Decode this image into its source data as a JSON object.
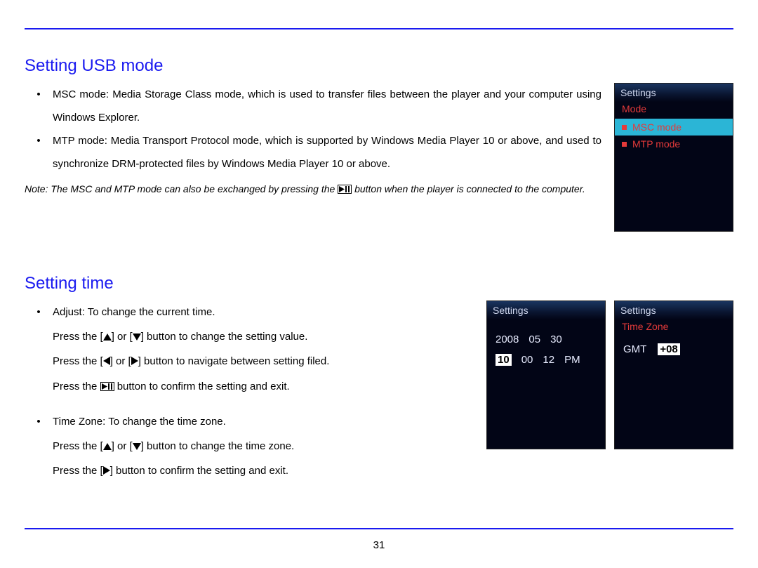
{
  "page_number": "31",
  "sections": {
    "usb": {
      "heading": "Setting USB mode",
      "bullets": [
        "MSC mode: Media Storage Class mode, which is used to transfer files between the player and your computer using Windows Explorer.",
        "MTP mode: Media Transport Protocol mode, which is supported by Windows Media Player 10 or above, and used to synchronize DRM-protected files by Windows Media Player 10 or above."
      ],
      "note_pre": "Note: The MSC and MTP mode can also be exchanged by pressing the ",
      "note_post": " button when the player is connected to the computer."
    },
    "time": {
      "heading": "Setting time",
      "b1": "Adjust: To change the current time.",
      "l1a": "Press the [",
      "l1b": "] or [",
      "l1c": "] button to change the setting value.",
      "l2a": "Press the [",
      "l2b": "] or [",
      "l2c": "] button to navigate between setting filed.",
      "l3a": "Press the ",
      "l3b": " button to confirm the setting and exit.",
      "b2": "Time Zone: To change the time zone.",
      "l4a": "Press the [",
      "l4b": "] or [",
      "l4c": "] button to change the time zone.",
      "l5a": "Press the [",
      "l5b": "] button to confirm the setting and exit."
    }
  },
  "device_usb": {
    "header": "Settings",
    "sub": "Mode",
    "items": [
      {
        "label": "MSC mode",
        "selected": true
      },
      {
        "label": "MTP mode",
        "selected": false
      }
    ]
  },
  "device_time": {
    "header": "Settings",
    "date": {
      "y": "2008",
      "m": "05",
      "d": "30"
    },
    "clock": {
      "hh": "10",
      "mm": "00",
      "ss": "12",
      "ampm": "PM"
    }
  },
  "device_tz": {
    "header": "Settings",
    "sub": "Time Zone",
    "gmt_label": "GMT",
    "gmt_value": "+08"
  },
  "bullet_glyph": "•"
}
